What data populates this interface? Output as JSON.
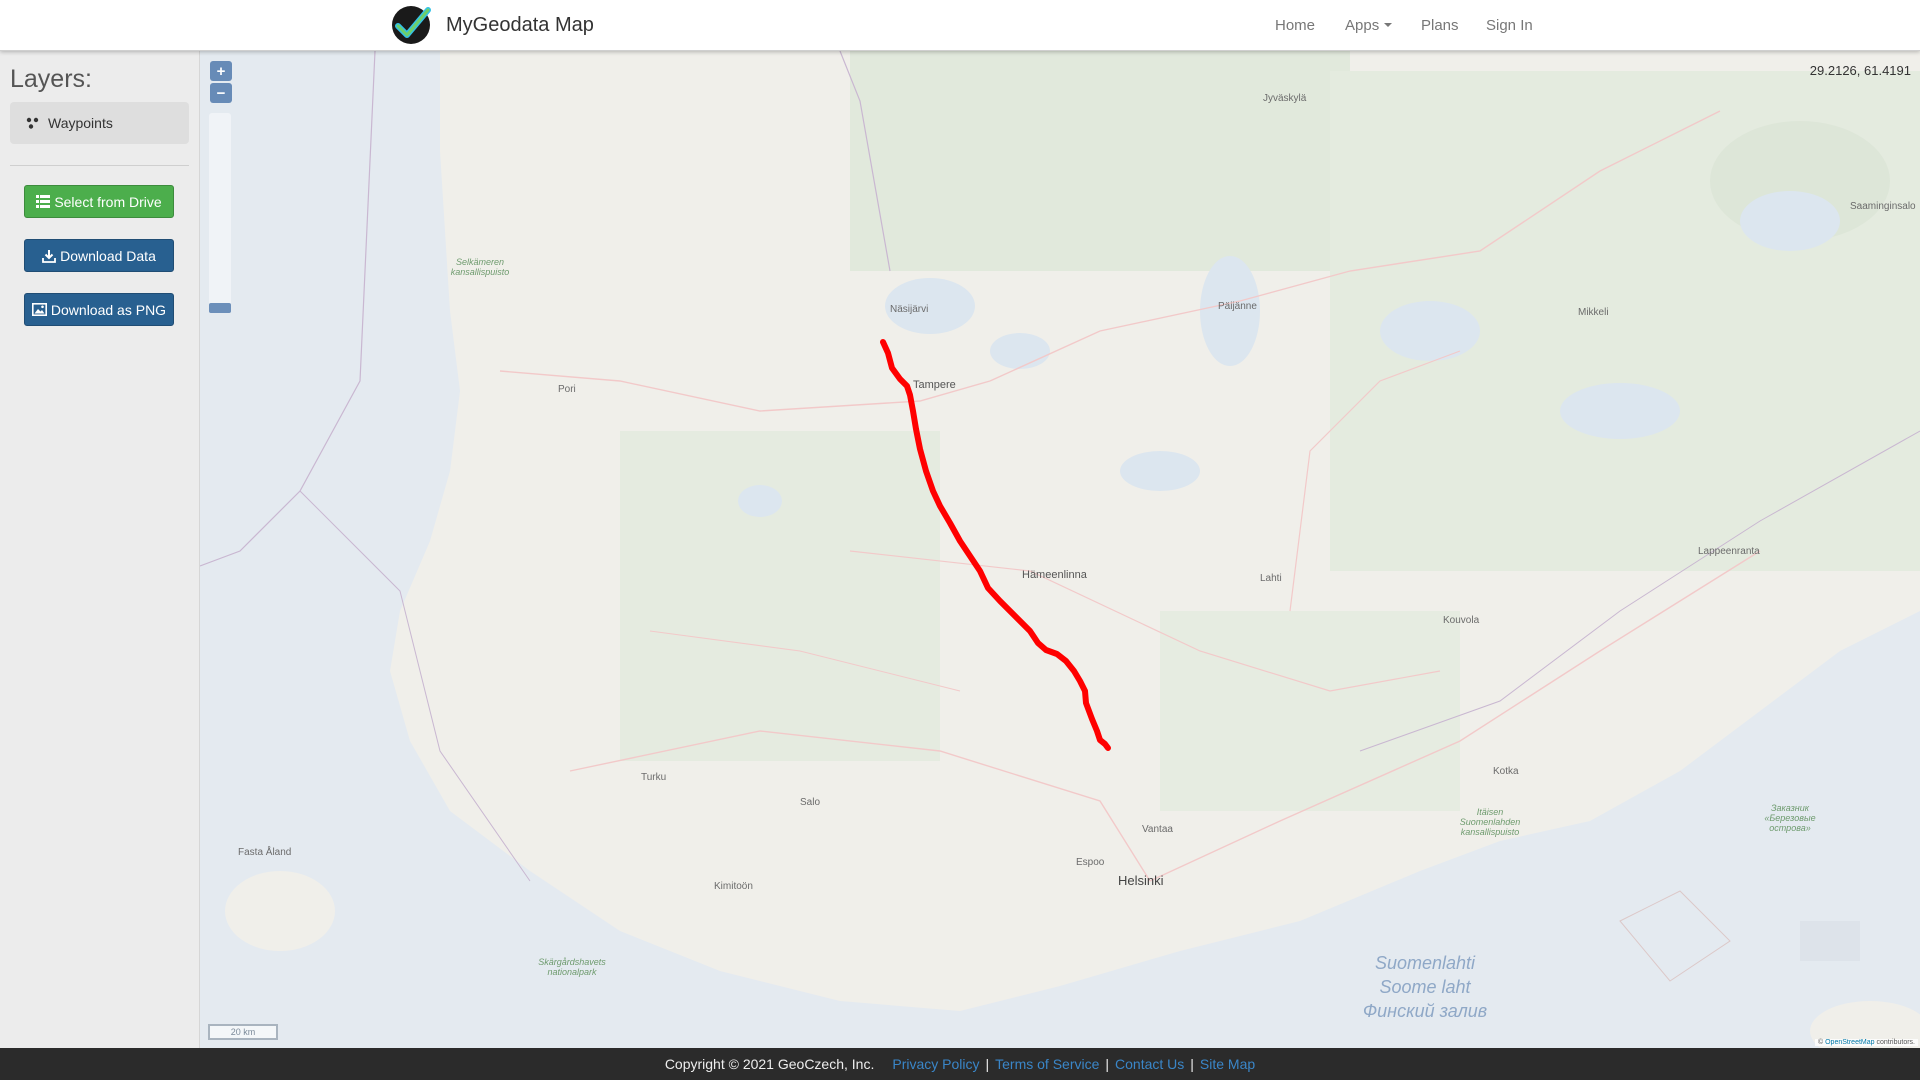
{
  "header": {
    "brand_name": "MyGeodata Map",
    "nav": [
      {
        "label": "Home"
      },
      {
        "label": "Apps",
        "has_caret": true
      },
      {
        "label": "Plans"
      },
      {
        "label": "Sign In"
      }
    ]
  },
  "sidebar": {
    "title": "Layers:",
    "layers": [
      {
        "label": "Waypoints",
        "icon": "waypoints-icon"
      }
    ],
    "buttons": {
      "select_drive": "Select from Drive",
      "download_data": "Download Data",
      "download_png": "Download as PNG"
    }
  },
  "map": {
    "coordinates": "29.2126, 61.4191",
    "zoom_in": "+",
    "zoom_out": "−",
    "scale_label": "20 km",
    "attribution_prefix": "© ",
    "attribution_link": "OpenStreetMap",
    "attribution_suffix": " contributors.",
    "route_color": "#ff0000",
    "places": {
      "jyvaskyla": "Jyväskylä",
      "naasijarvi": "Näsijärvi",
      "tampere": "Tampere",
      "pori": "Pori",
      "paijanne": "Päijänne",
      "mikkeli": "Mikkeli",
      "hameenlinna": "Hämeenlinna",
      "lahti": "Lahti",
      "kouvola": "Kouvola",
      "lappeenranta": "Lappeenranta",
      "kotka": "Kotka",
      "turku": "Turku",
      "salo": "Salo",
      "vantaa": "Vantaa",
      "espoo": "Espoo",
      "helsinki": "Helsinki",
      "kimitoon": "Kimitoön",
      "fasta_aland": "Fasta Åland",
      "saaminginsalo": "Saaminginsalo",
      "selkameren": "Selkämeren kansallispuisto",
      "skargards": "Skärgårdshavets nationalpark",
      "itainen": "Itäisen Suomenlahden kansallispuisto",
      "russian_islands": "Заказник «Березовые острова»",
      "gulf_fi": "Suomenlahti",
      "gulf_et": "Soome laht",
      "gulf_ru": "Финский залив"
    }
  },
  "footer": {
    "copyright": "Copyright © 2021 GeoCzech, Inc.",
    "links": [
      "Privacy Policy",
      "Terms of Service",
      "Contact Us",
      "Site Map"
    ],
    "separator": "|"
  }
}
